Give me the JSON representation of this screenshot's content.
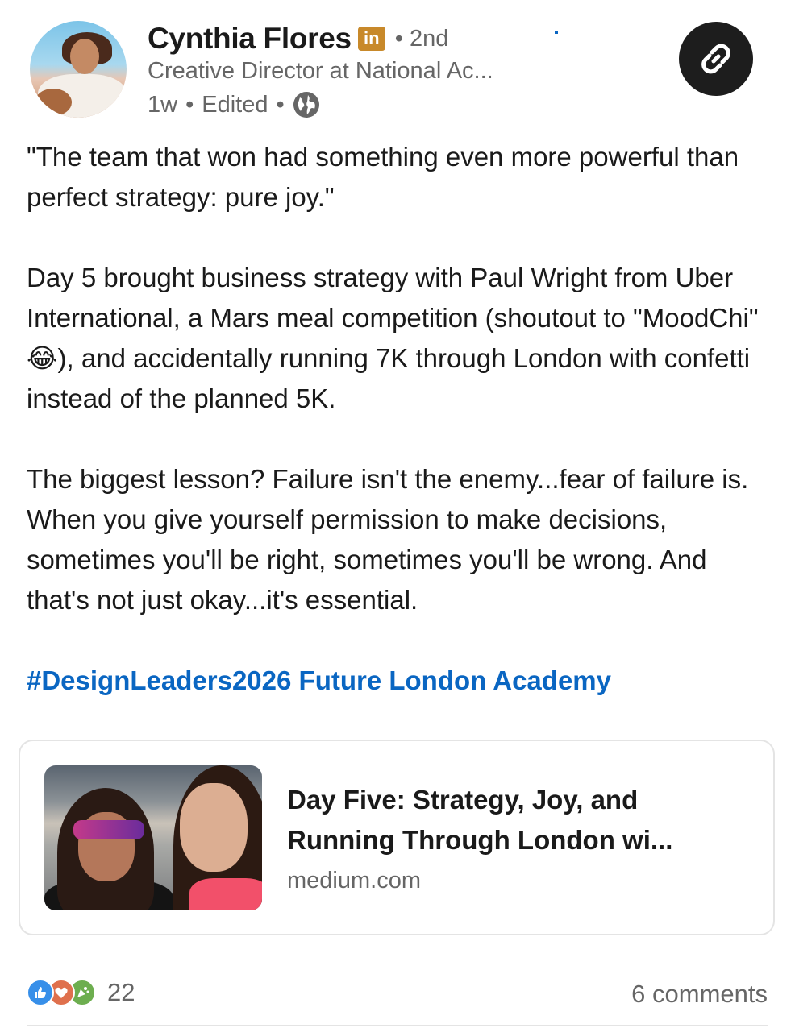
{
  "author": {
    "name": "Cynthia Flores",
    "badge": "in",
    "degree": "• 2nd",
    "headline": "Creative Director at National Ac...",
    "time": "1w",
    "edited": "Edited",
    "sep1": "•",
    "sep2": "•",
    "visibility_icon": "globe-icon"
  },
  "actions": {
    "link_icon": "link-icon"
  },
  "post": {
    "paragraphs": [
      "\"The team that won had something even more powerful than perfect strategy: pure joy.\"",
      "Day 5 brought business strategy with Paul Wright from Uber International, a Mars meal competition (shoutout to \"MoodChi\" 😂), and accidentally running 7K through London with confetti instead of the planned 5K.",
      "The biggest lesson? Failure isn't the enemy...fear of failure is. When you give yourself permission to make decisions, sometimes you'll be right, sometimes you'll be wrong. And that's not just okay...it's essential."
    ],
    "hashtag": "#DesignLeaders2026",
    "mention": "Future London Academy"
  },
  "link_card": {
    "title": "Day Five: Strategy, Joy, and Running Through London wi...",
    "domain": "medium.com"
  },
  "social": {
    "reaction_count": "22",
    "comments": "6 comments",
    "reaction_icons": [
      "like-icon",
      "love-icon",
      "celebrate-icon"
    ]
  },
  "colors": {
    "link_blue": "#0a66c2",
    "linkedin_badge": "#c8892a",
    "like": "#378fe9",
    "love": "#df704d",
    "celebrate": "#6dae4f"
  }
}
